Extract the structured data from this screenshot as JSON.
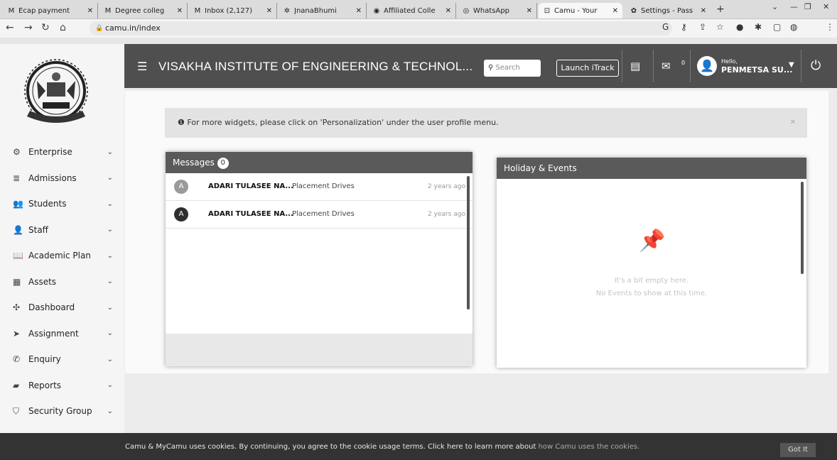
{
  "browser": {
    "tabs": [
      {
        "icon": "gmail-icon",
        "glyph": "M",
        "title": "Ecap payment"
      },
      {
        "icon": "gmail-icon",
        "glyph": "M",
        "title": "Degree colleg"
      },
      {
        "icon": "gmail-icon",
        "glyph": "M",
        "title": "Inbox (2,127)"
      },
      {
        "icon": "jnanabhumi-icon",
        "glyph": "✲",
        "title": "JnanaBhumi"
      },
      {
        "icon": "globe-icon",
        "glyph": "◉",
        "title": "Affiliated Colle"
      },
      {
        "icon": "whatsapp-icon",
        "glyph": "◎",
        "title": "WhatsApp"
      },
      {
        "icon": "camu-icon",
        "glyph": "⊡",
        "title": "Camu - Your"
      },
      {
        "icon": "settings-icon",
        "glyph": "✿",
        "title": "Settings - Pass"
      }
    ],
    "url": "camu.in/index"
  },
  "header": {
    "title": "VISAKHA INSTITUTE OF ENGINEERING & TECHNOL...",
    "search_placeholder": "Search",
    "launch_label": "Launch iTrack",
    "mail_count": "0",
    "hello": "Hello,",
    "user_name": "PENMETSA SU..."
  },
  "sidebar": {
    "items": [
      {
        "label": "Enterprise",
        "icon": "gears-icon",
        "glyph": "⚙"
      },
      {
        "label": "Admissions",
        "icon": "list-icon",
        "glyph": "≣"
      },
      {
        "label": "Students",
        "icon": "users-icon",
        "glyph": "👥"
      },
      {
        "label": "Staff",
        "icon": "user-icon",
        "glyph": "👤"
      },
      {
        "label": "Academic Plan",
        "icon": "book-icon",
        "glyph": "📖"
      },
      {
        "label": "Assets",
        "icon": "calendar-icon",
        "glyph": "▦"
      },
      {
        "label": "Dashboard",
        "icon": "dashboard-icon",
        "glyph": "✣"
      },
      {
        "label": "Assignment",
        "icon": "tag-icon",
        "glyph": "➤"
      },
      {
        "label": "Enquiry",
        "icon": "phone-icon",
        "glyph": "✆"
      },
      {
        "label": "Reports",
        "icon": "folder-icon",
        "glyph": "▰"
      },
      {
        "label": "Security Group",
        "icon": "shield-icon",
        "glyph": "⛉"
      }
    ]
  },
  "main": {
    "info_text": "For more widgets, please click on 'Personalization' under the user profile menu.",
    "messages": {
      "title": "Messages",
      "count": "0",
      "items": [
        {
          "avatar": "A",
          "avatar_color": "#9a9a9a",
          "name": "ADARI TULASEE NA...",
          "subject": "Placement Drives",
          "time": "2 years ago"
        },
        {
          "avatar": "A",
          "avatar_color": "#2e2e2e",
          "name": "ADARI TULASEE NA...",
          "subject": "Placement Drives",
          "time": "2 years ago"
        }
      ]
    },
    "events": {
      "title": "Holiday & Events",
      "empty_line1": "It's a bit empty here.",
      "empty_line2": "No Events to show at this time."
    }
  },
  "cookie": {
    "text": "Camu & MyCamu uses cookies. By continuing, you agree to the cookie usage terms. Click here to learn more about ",
    "link": "how Camu uses the cookies.",
    "button": "Got It"
  }
}
